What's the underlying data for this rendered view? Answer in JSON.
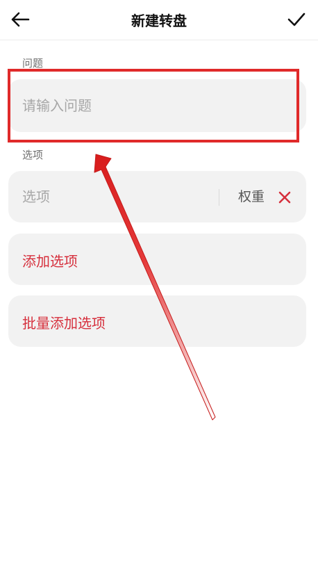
{
  "header": {
    "title": "新建转盘",
    "back_icon": "arrow-left-icon",
    "confirm_icon": "check-icon"
  },
  "question": {
    "label": "问题",
    "placeholder": "请输入问题",
    "value": ""
  },
  "options": {
    "label": "选项",
    "items": [
      {
        "placeholder": "选项",
        "value": "",
        "weight_placeholder": "权重",
        "weight_value": ""
      }
    ],
    "add_label": "添加选项",
    "batch_add_label": "批量添加选项"
  },
  "colors": {
    "accent": "#d62f3c",
    "annotation": "#e02a2a",
    "card_bg": "#f2f2f2"
  }
}
